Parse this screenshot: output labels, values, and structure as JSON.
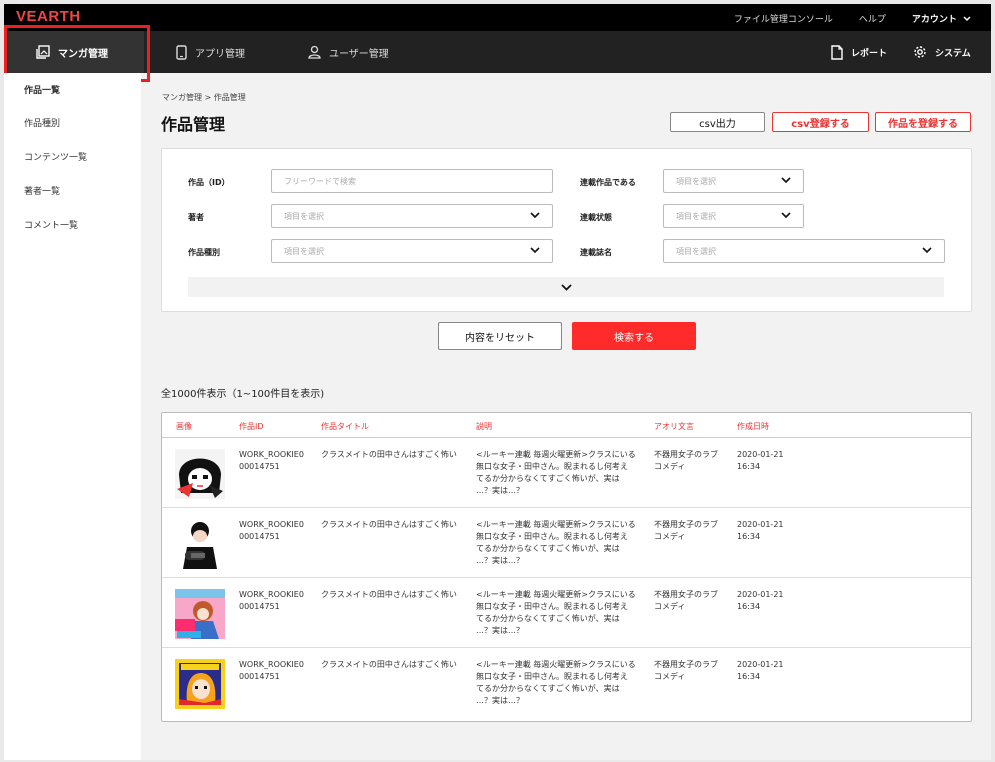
{
  "topbar": {
    "logo": "VEARTH",
    "links": [
      "ファイル管理コンソール",
      "ヘルプ"
    ],
    "account": "アカウント"
  },
  "nav": {
    "tabs": [
      {
        "label": "マンガ管理",
        "icon": "image-icon",
        "active": true
      },
      {
        "label": "アプリ管理",
        "icon": "smartphone-icon"
      },
      {
        "label": "ユーザー管理",
        "icon": "user-icon"
      }
    ],
    "report": "レポート",
    "system": "システム"
  },
  "sidebar": {
    "items": [
      {
        "label": "作品一覧",
        "active": true
      },
      {
        "label": "作品種別"
      },
      {
        "label": "コンテンツ一覧"
      },
      {
        "label": "著者一覧"
      },
      {
        "label": "コメント一覧"
      }
    ]
  },
  "main": {
    "breadcrumb": "マンガ管理 > 作品管理",
    "title": "作品管理",
    "buttons": {
      "csv_export": "csv出力",
      "csv_register": "csv登録する",
      "register": "作品を登録する"
    }
  },
  "filters": {
    "work_label": "作品（ID）",
    "work_placeholder": "フリーワードで検索",
    "author_label": "著者",
    "author_placeholder": "項目を選択",
    "type_label": "作品種別",
    "type_placeholder": "項目を選択",
    "serial_label": "連載作品である",
    "serial_placeholder": "項目を選択",
    "status_label": "連載状態",
    "status_placeholder": "項目を選択",
    "magazine_label": "連載誌名",
    "magazine_placeholder": "項目を選択"
  },
  "actions": {
    "reset": "内容をリセット",
    "search": "検索する"
  },
  "results": {
    "count_text": "全1000件表示（1~100件目を表示)",
    "columns": [
      "画像",
      "作品ID",
      "作品タイトル",
      "説明",
      "アオリ文言",
      "作成日時"
    ],
    "rows": [
      {
        "id": "WORK_ROOKIE0\n00014751",
        "title": "クラスメイトの田中さんはすごく怖い",
        "desc": "<ルーキー連載 毎週火曜更新>クラスにいる\n無口な女子・田中さん。睨まれるし何考え\nてるか分からなくてすごく怖いが、実は\n…？実は…？",
        "aori": "不器用女子のラブ\nコメディ",
        "date": "2020-01-21\n16:34",
        "thumb": "manga-thumbnail-1"
      },
      {
        "id": "WORK_ROOKIE0\n00014751",
        "title": "クラスメイトの田中さんはすごく怖い",
        "desc": "<ルーキー連載 毎週火曜更新>クラスにいる\n無口な女子・田中さん。睨まれるし何考え\nてるか分からなくてすごく怖いが、実は\n…？実は…？",
        "aori": "不器用女子のラブ\nコメディ",
        "date": "2020-01-21\n16:34",
        "thumb": "manga-thumbnail-2"
      },
      {
        "id": "WORK_ROOKIE0\n00014751",
        "title": "クラスメイトの田中さんはすごく怖い",
        "desc": "<ルーキー連載 毎週火曜更新>クラスにいる\n無口な女子・田中さん。睨まれるし何考え\nてるか分からなくてすごく怖いが、実は\n…？実は…？",
        "aori": "不器用女子のラブ\nコメディ",
        "date": "2020-01-21\n16:34",
        "thumb": "manga-thumbnail-3"
      },
      {
        "id": "WORK_ROOKIE0\n00014751",
        "title": "クラスメイトの田中さんはすごく怖い",
        "desc": "<ルーキー連載 毎週火曜更新>クラスにいる\n無口な女子・田中さん。睨まれるし何考え\nてるか分からなくてすごく怖いが、実は\n…？実は…？",
        "aori": "不器用女子のラブ\nコメディ",
        "date": "2020-01-21\n16:34",
        "thumb": "manga-thumbnail-4"
      }
    ]
  },
  "colors": {
    "accent": "#ff2a2a",
    "header_bg": "#000000",
    "nav_bg": "#222222",
    "highlight": "#ee1f1f"
  }
}
